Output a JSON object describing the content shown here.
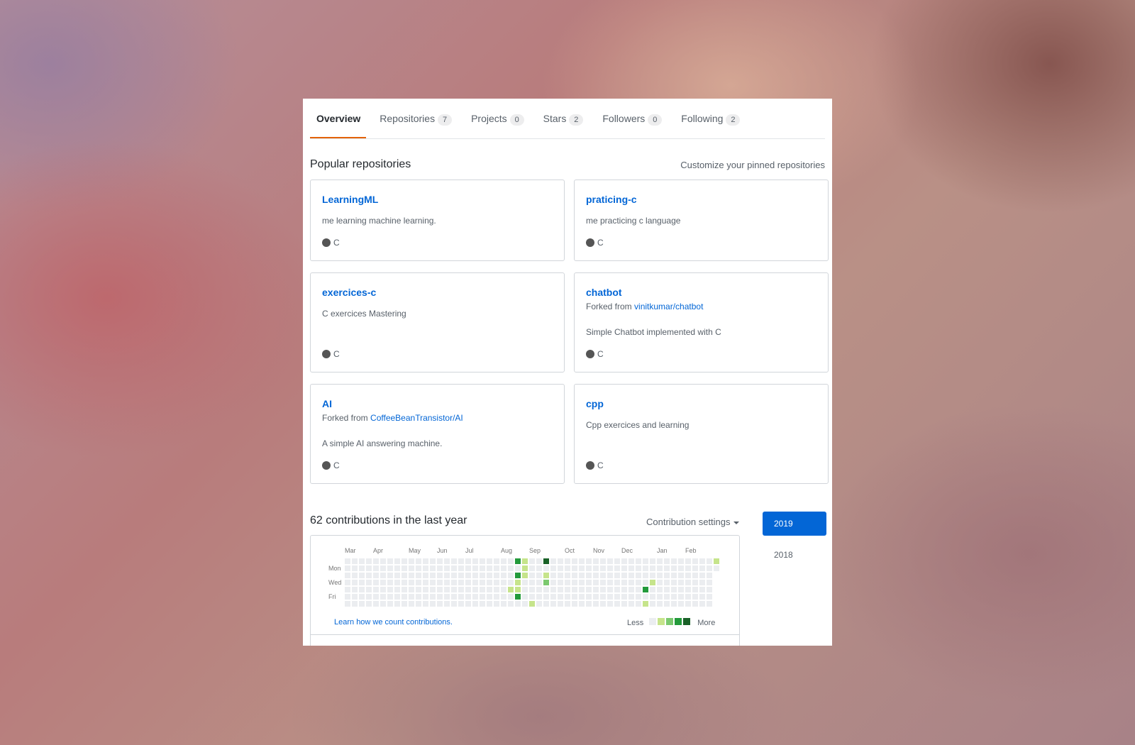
{
  "tabs": [
    {
      "label": "Overview",
      "count": ""
    },
    {
      "label": "Repositories",
      "count": "7"
    },
    {
      "label": "Projects",
      "count": "0"
    },
    {
      "label": "Stars",
      "count": "2"
    },
    {
      "label": "Followers",
      "count": "0"
    },
    {
      "label": "Following",
      "count": "2"
    }
  ],
  "pinned": {
    "title": "Popular repositories",
    "customize_link": "Customize your pinned repositories",
    "repos": [
      {
        "name": "LearningML",
        "fork_prefix": "",
        "fork_source": "",
        "description": "me learning machine learning.",
        "language": "C"
      },
      {
        "name": "praticing-c",
        "fork_prefix": "",
        "fork_source": "",
        "description": "me practicing c language",
        "language": "C"
      },
      {
        "name": "exercices-c",
        "fork_prefix": "",
        "fork_source": "",
        "description": "C exercices Mastering",
        "language": "C"
      },
      {
        "name": "chatbot",
        "fork_prefix": "Forked from",
        "fork_source": "vinitkumar/chatbot",
        "description": "Simple Chatbot implemented with C",
        "language": "C"
      },
      {
        "name": "AI",
        "fork_prefix": "Forked from",
        "fork_source": "CoffeeBeanTransistor/AI",
        "description": "A simple AI answering machine.",
        "language": "C"
      },
      {
        "name": "cpp",
        "fork_prefix": "",
        "fork_source": "",
        "description": "Cpp exercices and learning",
        "language": "C"
      }
    ],
    "language_color": "#555555"
  },
  "contributions": {
    "title": "62 contributions in the last year",
    "settings_label": "Contribution settings",
    "months": [
      "Mar",
      "Apr",
      "May",
      "Jun",
      "Jul",
      "Aug",
      "Sep",
      "Oct",
      "Nov",
      "Dec",
      "Jan",
      "Feb"
    ],
    "month_weeks": [
      0,
      4,
      9,
      13,
      17,
      22,
      26,
      31,
      35,
      39,
      44,
      48
    ],
    "days": [
      "Mon",
      "Wed",
      "Fri"
    ],
    "weeks": 53,
    "last_week_days": 2,
    "active_cells": [
      {
        "week": 24,
        "day": 0,
        "level": 3
      },
      {
        "week": 25,
        "day": 0,
        "level": 1
      },
      {
        "week": 28,
        "day": 0,
        "level": 4
      },
      {
        "week": 25,
        "day": 1,
        "level": 1
      },
      {
        "week": 24,
        "day": 2,
        "level": 3
      },
      {
        "week": 25,
        "day": 2,
        "level": 1
      },
      {
        "week": 28,
        "day": 2,
        "level": 1
      },
      {
        "week": 24,
        "day": 3,
        "level": 1
      },
      {
        "week": 28,
        "day": 3,
        "level": 2
      },
      {
        "week": 24,
        "day": 4,
        "level": 1
      },
      {
        "week": 23,
        "day": 4,
        "level": 1
      },
      {
        "week": 43,
        "day": 3,
        "level": 1
      },
      {
        "week": 42,
        "day": 4,
        "level": 3
      },
      {
        "week": 24,
        "day": 5,
        "level": 3
      },
      {
        "week": 26,
        "day": 6,
        "level": 1
      },
      {
        "week": 42,
        "day": 6,
        "level": 1
      },
      {
        "week": 52,
        "day": 0,
        "level": 1
      }
    ],
    "level_colors": [
      "#ebedf0",
      "#c6e48b",
      "#7bc96f",
      "#239a3b",
      "#196127"
    ],
    "learn_link": "Learn how we count contributions.",
    "legend_less": "Less",
    "legend_more": "More"
  },
  "years": {
    "selected": "2019",
    "other": "2018"
  }
}
